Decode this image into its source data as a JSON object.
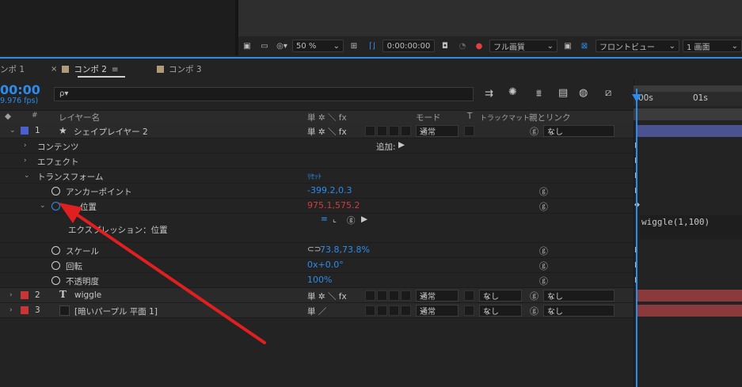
{
  "viewer": {
    "zoom": "50 %",
    "timecode": "0:00:00:00",
    "resolution": "フル画質",
    "view": "フロントビュー",
    "layout": "1 画面"
  },
  "tabs": [
    {
      "label": "ンポ 1",
      "color": "#b09a7a"
    },
    {
      "label": "コンポ 2",
      "color": "#b09a7a",
      "active": true
    },
    {
      "label": "コンポ 3",
      "color": "#b09a7a"
    }
  ],
  "comp": {
    "time": "00:00",
    "fps": "9.976 fps)",
    "search_placeholder": "ρ▾"
  },
  "columns": {
    "layer_name": "レイヤー名",
    "switch_icons": "単 ✲ ＼ fx",
    "mode": "モード",
    "t": "T",
    "trackmatte": "トラックマット",
    "parent": "親とリンク"
  },
  "layers": [
    {
      "index": "1",
      "name": "シェイプレイヤー 2",
      "color": "#4a5fd0",
      "mode": "通常",
      "parent": "なし",
      "icon": "star-icon"
    },
    {
      "index": "2",
      "name": "wiggle",
      "color": "#c83535",
      "mode": "通常",
      "trackmatte": "なし",
      "parent": "なし",
      "icon": "text-icon"
    },
    {
      "index": "3",
      "name": "[暗いパープル 平面 1]",
      "color": "#c83535",
      "mode": "通常",
      "trackmatte": "なし",
      "parent": "なし",
      "icon": "solid-icon"
    }
  ],
  "properties": {
    "contents": "コンテンツ",
    "add": "追加:",
    "effects": "エフェクト",
    "transform": "トランスフォーム",
    "reset": "ﾘｾｯﾄ",
    "anchor": {
      "label": "アンカーポイント",
      "value": "-399.2,0.3"
    },
    "position": {
      "label": "位置",
      "value": "975.1,575.2"
    },
    "expression_label": "エクスプレッション：位置",
    "scale": {
      "label": "スケール",
      "value": "73.8,73.8%"
    },
    "rotation": {
      "label": "回転",
      "value": "0x+0.0°"
    },
    "opacity": {
      "label": "不透明度",
      "value": "100%"
    }
  },
  "timeline": {
    "tick0": "00s",
    "tick1": "01s",
    "expression_code": "wiggle(1,100)"
  },
  "colors": {
    "accent": "#2d8ceb",
    "arrow": "#e02020",
    "keyed_value": "#d23c3c"
  }
}
